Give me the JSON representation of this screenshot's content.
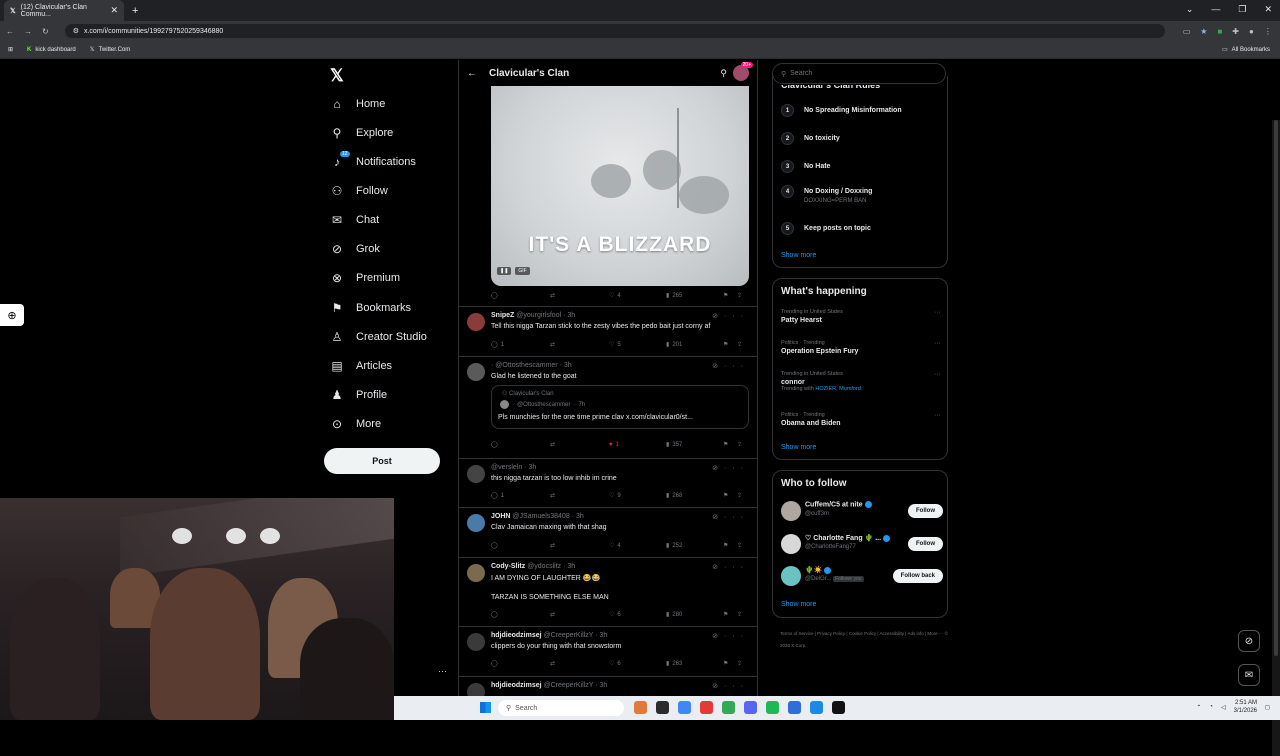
{
  "browser": {
    "tab_title": "(12) Clavicular's Clan Commu...",
    "url": "x.com/i/communities/1992797520259346880",
    "bookmarks": [
      "kick dashboard",
      "Twitter.Com"
    ],
    "all_bookmarks": "All Bookmarks"
  },
  "nav": {
    "items": [
      {
        "label": "Home",
        "icon": "home-icon"
      },
      {
        "label": "Explore",
        "icon": "search-icon"
      },
      {
        "label": "Notifications",
        "icon": "bell-icon",
        "badge": "12"
      },
      {
        "label": "Follow",
        "icon": "person-plus-icon"
      },
      {
        "label": "Chat",
        "icon": "envelope-icon"
      },
      {
        "label": "Grok",
        "icon": "grok-icon"
      },
      {
        "label": "Premium",
        "icon": "x-premium-icon"
      },
      {
        "label": "Bookmarks",
        "icon": "bookmark-icon"
      },
      {
        "label": "Creator Studio",
        "icon": "creator-icon"
      },
      {
        "label": "Articles",
        "icon": "article-icon"
      },
      {
        "label": "Profile",
        "icon": "person-icon"
      },
      {
        "label": "More",
        "icon": "more-circle-icon"
      }
    ],
    "post_label": "Post"
  },
  "feed": {
    "title": "Clavicular's Clan",
    "header_badge": "20+",
    "gif": {
      "caption": "IT'S A BLIZZARD",
      "tag": "GIF",
      "replies": "",
      "likes": "4",
      "views": "265"
    },
    "tweets": [
      {
        "name": "SnipeZ",
        "handle": "@yourgirlsfool",
        "time": "3h",
        "text": "Tell this nigga Tarzan stick to the zesty vibes the pedo bait just corny af",
        "replies": "1",
        "likes": "5",
        "views": "201",
        "avatar": "#8a3b3b"
      },
      {
        "name": "",
        "handle": "@Ottosthescammer",
        "time": "3h",
        "text": "Glad he listened to the goat",
        "replies": "",
        "likes": "1",
        "views": "357",
        "avatar": "#5a5a5a",
        "quote": {
          "community": "Clavicular's Clan",
          "handle": "@Ottosthescammer",
          "time": "7h",
          "text": "Pls munchies for the one time prime clav x.com/clavicular0/st..."
        }
      },
      {
        "name": "",
        "handle": "@versleln",
        "time": "3h",
        "text": "this nigga tarzan is too low inhib im crine",
        "replies": "1",
        "likes": "9",
        "views": "268",
        "avatar": "#444"
      },
      {
        "name": "JOHN",
        "handle": "@JSamuels38408",
        "time": "3h",
        "text": "Clav Jamaican maxing with that shag",
        "replies": "",
        "likes": "4",
        "views": "252",
        "avatar": "#4a7aa8"
      },
      {
        "name": "Cody-Slitz",
        "handle": "@ydocslitz",
        "time": "3h",
        "text": "I AM DYING OF LAUGHTER 😂😂",
        "text2": "TARZAN IS SOMETHING ELSE MAN",
        "replies": "",
        "likes": "6",
        "views": "280",
        "avatar": "#7a6a50"
      },
      {
        "name": "hdjdieodzimsej",
        "handle": "@CreeperKillzY",
        "time": "3h",
        "text": "clippers do your thing with that snowstorm",
        "replies": "",
        "likes": "6",
        "views": "263",
        "avatar": "#3a3a3a"
      },
      {
        "name": "hdjdieodzimsej",
        "handle": "@CreeperKillzY",
        "time": "3h",
        "text": "",
        "avatar": "#3a3a3a"
      }
    ]
  },
  "right": {
    "search_placeholder": "Search",
    "rules_title": "Clavicular's Clan Rules",
    "rules": [
      {
        "n": "1",
        "text": "No Spreading Misinformation",
        "sub": ""
      },
      {
        "n": "2",
        "text": "No toxicity",
        "sub": ""
      },
      {
        "n": "3",
        "text": "No Hate",
        "sub": ""
      },
      {
        "n": "4",
        "text": "No Doxing / Doxxing",
        "sub": "DOXXING=PERM BAN"
      },
      {
        "n": "5",
        "text": "Keep posts on topic",
        "sub": ""
      }
    ],
    "show_more": "Show more",
    "happening_title": "What's happening",
    "trends": [
      {
        "context": "Trending in United States",
        "name": "Patty Hearst",
        "with": ""
      },
      {
        "context": "Politics · Trending",
        "name": "Operation Epstein Fury",
        "with": ""
      },
      {
        "context": "Trending in United States",
        "name": "connor",
        "with_label": "Trending with",
        "with": "HOZIER, Mumford"
      },
      {
        "context": "Politics · Trending",
        "name": "Obama and Biden",
        "with": ""
      }
    ],
    "who_title": "Who to follow",
    "who": [
      {
        "name": "Cuffem/C5 at nite",
        "handle": "@cuff3m",
        "button": "Follow",
        "avatar": "#b0a6a0"
      },
      {
        "name": "♡ Charlotte Fang 🌵 ...",
        "handle": "@CharlotteFang77",
        "button": "Follow",
        "avatar": "#d8d8d8"
      },
      {
        "name": "🌵☀️",
        "handle": "@DelGr...",
        "extra": "Follows you",
        "button": "Follow back",
        "avatar": "#6ac3c3"
      }
    ],
    "footer": "Terms of Service | Privacy Policy | Cookie Policy | Accessibility | Ads info | More ··· © 2026 X Corp."
  },
  "taskbar": {
    "search_placeholder": "Search",
    "time": "2:51 AM",
    "date": "3/1/2026"
  }
}
